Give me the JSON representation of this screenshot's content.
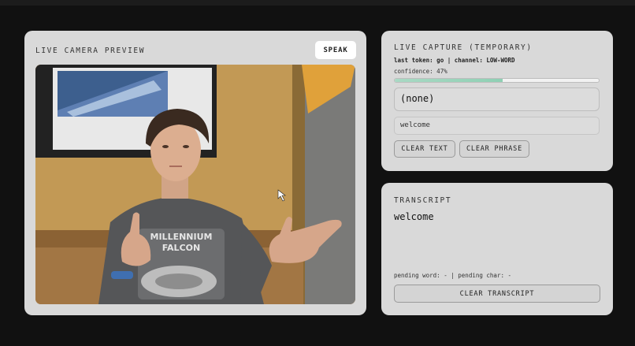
{
  "camera": {
    "title": "LIVE CAMERA PREVIEW",
    "speak_label": "SPEAK",
    "shirt_text_line1": "MILLENNIUM",
    "shirt_text_line2": "FALCON"
  },
  "capture": {
    "title": "LIVE CAPTURE (TEMPORARY)",
    "last_token_line": "last token: go | channel: LOW-WORD",
    "confidence_line": "confidence: 47%",
    "confidence_fraction": 0.53,
    "current_sign": "(none)",
    "phrase": "welcome",
    "clear_text_label": "CLEAR TEXT",
    "clear_phrase_label": "CLEAR PHRASE"
  },
  "transcript": {
    "title": "TRANSCRIPT",
    "text": "welcome",
    "pending_line": "pending word: - | pending char: -",
    "clear_label": "CLEAR TRANSCRIPT"
  },
  "colors": {
    "background": "#111111",
    "panel": "#d9d9d9",
    "confidence_fill": "#8fd0b4"
  }
}
